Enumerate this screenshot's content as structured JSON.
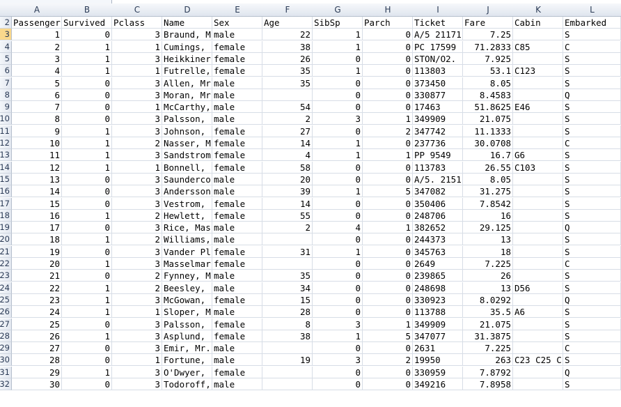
{
  "columns": [
    "A",
    "B",
    "C",
    "D",
    "E",
    "F",
    "G",
    "H",
    "I",
    "J",
    "K",
    "L"
  ],
  "selected_row": 1,
  "colors": {
    "header_bg": "#dfe5ee",
    "grid": "#d7dde6",
    "selected_rowhead": "#f9d88c"
  },
  "rows": [
    {
      "n": "2",
      "c": [
        "Passenger",
        "Survived",
        "Pclass",
        "Name",
        "Sex",
        "Age",
        "SibSp",
        "Parch",
        "Ticket",
        "Fare",
        "Cabin",
        "Embarked"
      ]
    },
    {
      "n": "3",
      "c": [
        "1",
        "0",
        "3",
        "Braund, M",
        "male",
        "22",
        "1",
        "0",
        "A/5 21171",
        "7.25",
        "",
        "S"
      ]
    },
    {
      "n": "4",
      "c": [
        "2",
        "1",
        "1",
        "Cumings,",
        "female",
        "38",
        "1",
        "0",
        "PC 17599",
        "71.2833",
        "C85",
        "C"
      ]
    },
    {
      "n": "5",
      "c": [
        "3",
        "1",
        "3",
        "Heikkiner",
        "female",
        "26",
        "0",
        "0",
        "STON/O2.",
        "7.925",
        "",
        "S"
      ]
    },
    {
      "n": "6",
      "c": [
        "4",
        "1",
        "1",
        "Futrelle,",
        "female",
        "35",
        "1",
        "0",
        "113803",
        "53.1",
        "C123",
        "S"
      ]
    },
    {
      "n": "7",
      "c": [
        "5",
        "0",
        "3",
        "Allen, Mr",
        "male",
        "35",
        "0",
        "0",
        "373450",
        "8.05",
        "",
        "S"
      ]
    },
    {
      "n": "8",
      "c": [
        "6",
        "0",
        "3",
        "Moran, Mr",
        "male",
        "",
        "0",
        "0",
        "330877",
        "8.4583",
        "",
        "Q"
      ]
    },
    {
      "n": "9",
      "c": [
        "7",
        "0",
        "1",
        "McCarthy,",
        "male",
        "54",
        "0",
        "0",
        "17463",
        "51.8625",
        "E46",
        "S"
      ]
    },
    {
      "n": "10",
      "c": [
        "8",
        "0",
        "3",
        "Palsson,",
        "male",
        "2",
        "3",
        "1",
        "349909",
        "21.075",
        "",
        "S"
      ]
    },
    {
      "n": "11",
      "c": [
        "9",
        "1",
        "3",
        "Johnson,",
        "female",
        "27",
        "0",
        "2",
        "347742",
        "11.1333",
        "",
        "S"
      ]
    },
    {
      "n": "12",
      "c": [
        "10",
        "1",
        "2",
        "Nasser, M",
        "female",
        "14",
        "1",
        "0",
        "237736",
        "30.0708",
        "",
        "C"
      ]
    },
    {
      "n": "13",
      "c": [
        "11",
        "1",
        "3",
        "Sandstrom",
        "female",
        "4",
        "1",
        "1",
        "PP 9549",
        "16.7",
        "G6",
        "S"
      ]
    },
    {
      "n": "14",
      "c": [
        "12",
        "1",
        "1",
        "Bonnell,",
        "female",
        "58",
        "0",
        "0",
        "113783",
        "26.55",
        "C103",
        "S"
      ]
    },
    {
      "n": "15",
      "c": [
        "13",
        "0",
        "3",
        "Saunderco",
        "male",
        "20",
        "0",
        "0",
        "A/5. 2151",
        "8.05",
        "",
        "S"
      ]
    },
    {
      "n": "16",
      "c": [
        "14",
        "0",
        "3",
        "Andersson",
        "male",
        "39",
        "1",
        "5",
        "347082",
        "31.275",
        "",
        "S"
      ]
    },
    {
      "n": "17",
      "c": [
        "15",
        "0",
        "3",
        "Vestrom,",
        "female",
        "14",
        "0",
        "0",
        "350406",
        "7.8542",
        "",
        "S"
      ]
    },
    {
      "n": "18",
      "c": [
        "16",
        "1",
        "2",
        "Hewlett,",
        "female",
        "55",
        "0",
        "0",
        "248706",
        "16",
        "",
        "S"
      ]
    },
    {
      "n": "19",
      "c": [
        "17",
        "0",
        "3",
        "Rice, Mas",
        "male",
        "2",
        "4",
        "1",
        "382652",
        "29.125",
        "",
        "Q"
      ]
    },
    {
      "n": "20",
      "c": [
        "18",
        "1",
        "2",
        "Williams,",
        "male",
        "",
        "0",
        "0",
        "244373",
        "13",
        "",
        "S"
      ]
    },
    {
      "n": "21",
      "c": [
        "19",
        "0",
        "3",
        "Vander Pl",
        "female",
        "31",
        "1",
        "0",
        "345763",
        "18",
        "",
        "S"
      ]
    },
    {
      "n": "22",
      "c": [
        "20",
        "1",
        "3",
        "Masselmar",
        "female",
        "",
        "0",
        "0",
        "2649",
        "7.225",
        "",
        "C"
      ]
    },
    {
      "n": "23",
      "c": [
        "21",
        "0",
        "2",
        "Fynney, M",
        "male",
        "35",
        "0",
        "0",
        "239865",
        "26",
        "",
        "S"
      ]
    },
    {
      "n": "24",
      "c": [
        "22",
        "1",
        "2",
        "Beesley,",
        "male",
        "34",
        "0",
        "0",
        "248698",
        "13",
        "D56",
        "S"
      ]
    },
    {
      "n": "25",
      "c": [
        "23",
        "1",
        "3",
        "McGowan,",
        "female",
        "15",
        "0",
        "0",
        "330923",
        "8.0292",
        "",
        "Q"
      ]
    },
    {
      "n": "26",
      "c": [
        "24",
        "1",
        "1",
        "Sloper, M",
        "male",
        "28",
        "0",
        "0",
        "113788",
        "35.5",
        "A6",
        "S"
      ]
    },
    {
      "n": "27",
      "c": [
        "25",
        "0",
        "3",
        "Palsson,",
        "female",
        "8",
        "3",
        "1",
        "349909",
        "21.075",
        "",
        "S"
      ]
    },
    {
      "n": "28",
      "c": [
        "26",
        "1",
        "3",
        "Asplund,",
        "female",
        "38",
        "1",
        "5",
        "347077",
        "31.3875",
        "",
        "S"
      ]
    },
    {
      "n": "29",
      "c": [
        "27",
        "0",
        "3",
        "Emir, Mr.",
        "male",
        "",
        "0",
        "0",
        "2631",
        "7.225",
        "",
        "C"
      ]
    },
    {
      "n": "30",
      "c": [
        "28",
        "0",
        "1",
        "Fortune,",
        "male",
        "19",
        "3",
        "2",
        "19950",
        "263",
        "C23 C25 C",
        "S"
      ]
    },
    {
      "n": "31",
      "c": [
        "29",
        "1",
        "3",
        "O'Dwyer,",
        "female",
        "",
        "0",
        "0",
        "330959",
        "7.8792",
        "",
        "Q"
      ]
    },
    {
      "n": "32",
      "c": [
        "30",
        "0",
        "3",
        "Todoroff,",
        "male",
        "",
        "0",
        "0",
        "349216",
        "7.8958",
        "",
        "S"
      ]
    }
  ]
}
